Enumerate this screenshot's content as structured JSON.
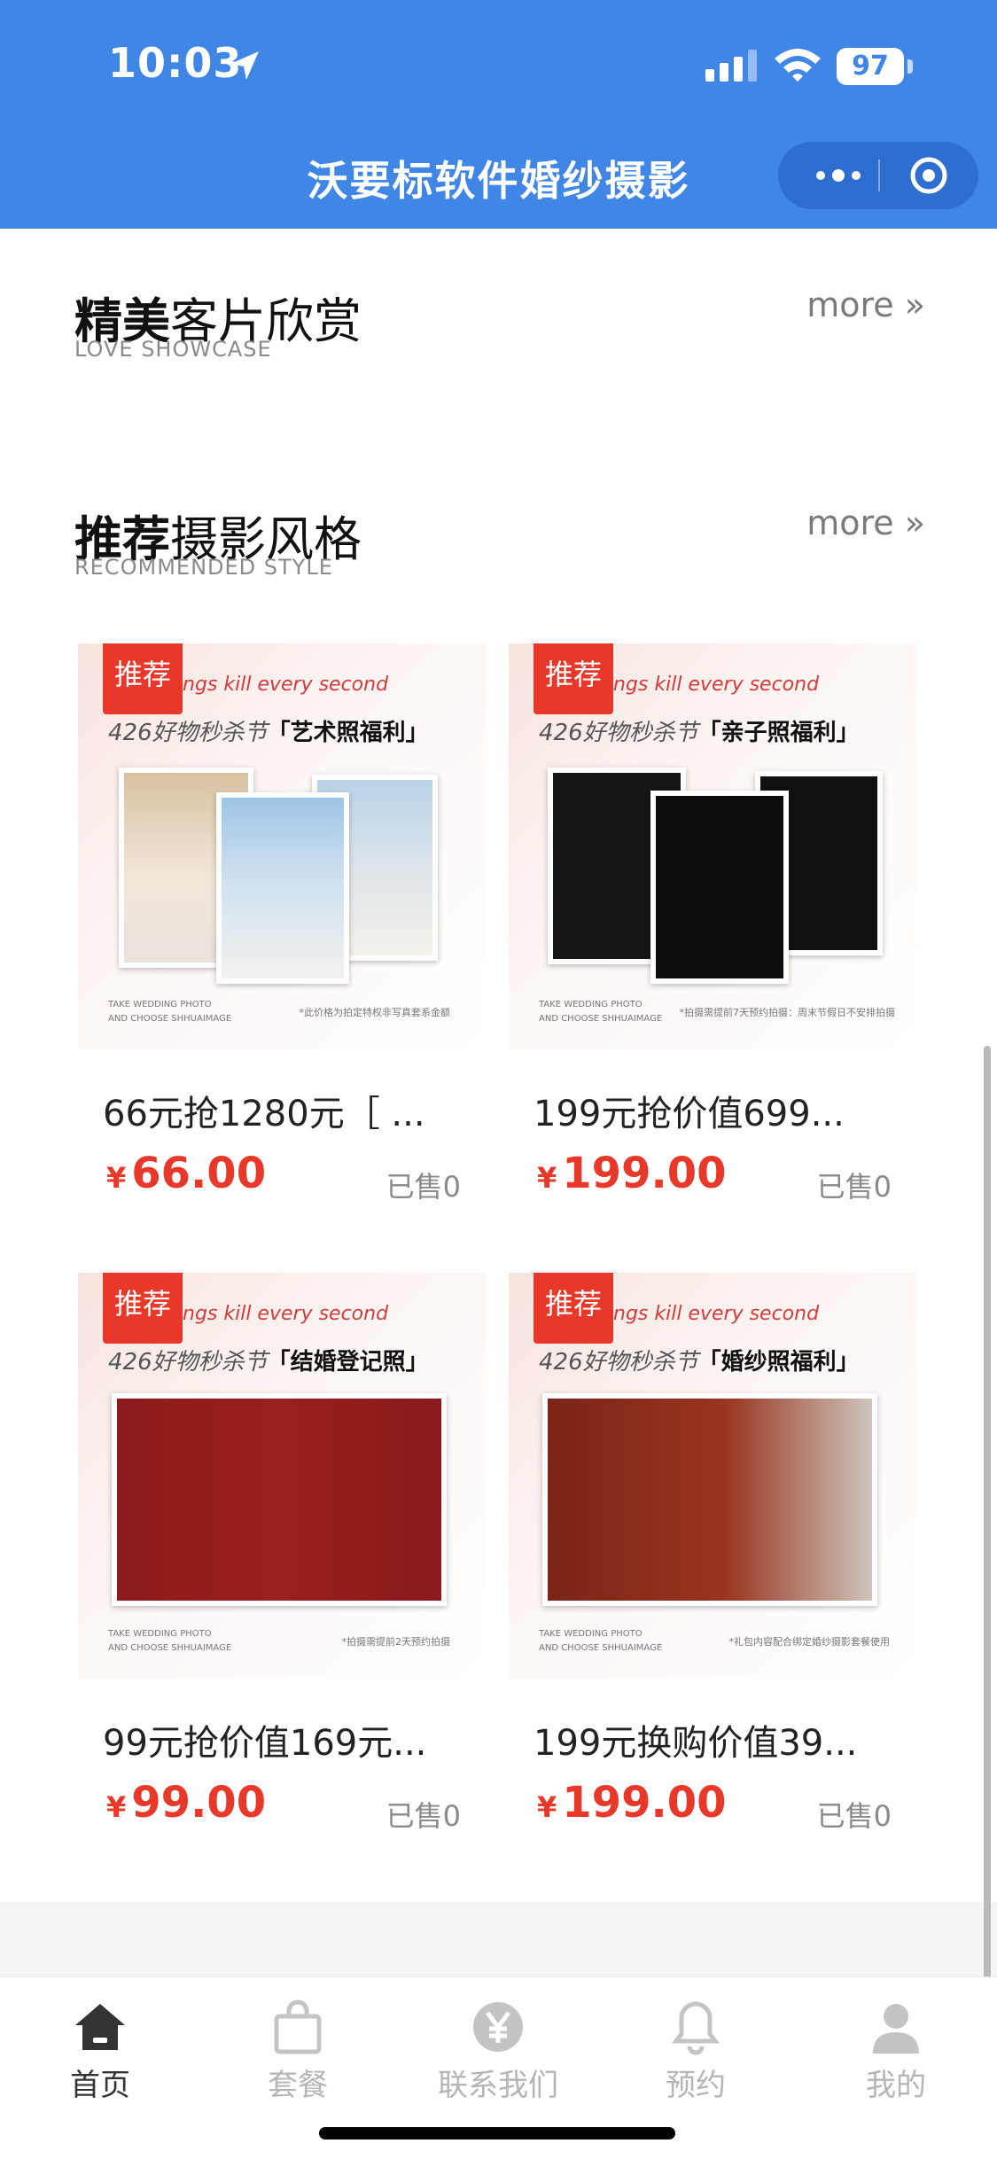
{
  "status_bar": {
    "time": "10:03",
    "battery": "97"
  },
  "nav": {
    "title": "沃要标软件婚纱摄影"
  },
  "sections": [
    {
      "title_bold": "精美",
      "title_rest": "客片欣赏",
      "subtitle": "LOVE SHOWCASE",
      "more": "more »"
    },
    {
      "title_bold": "推荐",
      "title_rest": "摄影风格",
      "subtitle": "RECOMMENDED STYLE",
      "more": "more »"
    }
  ],
  "products": [
    {
      "badge": "推荐",
      "banner_en": "ngs kill every second",
      "banner_cn_prefix": "426好物秒杀节",
      "banner_cn_tag": "「艺术照福利」",
      "foot_left_1": "TAKE WEDDING PHOTO",
      "foot_left_2": "AND CHOOSE SHHUAIMAGE",
      "foot_right": "*此价格为拍定特权非写真套系金额",
      "name": "66元抢1280元［ ...",
      "price": "66.00",
      "currency": "¥",
      "sold": "已售0"
    },
    {
      "badge": "推荐",
      "banner_en": "ngs kill every second",
      "banner_cn_prefix": "426好物秒杀节",
      "banner_cn_tag": "「亲子照福利」",
      "foot_left_1": "TAKE WEDDING PHOTO",
      "foot_left_2": "AND CHOOSE SHHUAIMAGE",
      "foot_right": "*拍摄需提前7天预约拍摄：周末节假日不安排拍摄",
      "name": "199元抢价值699...",
      "price": "199.00",
      "currency": "¥",
      "sold": "已售0"
    },
    {
      "badge": "推荐",
      "banner_en": "ngs kill every second",
      "banner_cn_prefix": "426好物秒杀节",
      "banner_cn_tag": "「结婚登记照」",
      "foot_left_1": "TAKE WEDDING PHOTO",
      "foot_left_2": "AND CHOOSE SHHUAIMAGE",
      "foot_right": "*拍摄需提前2天预约拍摄",
      "name": "99元抢价值169元...",
      "price": "99.00",
      "currency": "¥",
      "sold": "已售0"
    },
    {
      "badge": "推荐",
      "banner_en": "ngs kill every second",
      "banner_cn_prefix": "426好物秒杀节",
      "banner_cn_tag": "「婚纱照福利」",
      "foot_left_1": "TAKE WEDDING PHOTO",
      "foot_left_2": "AND CHOOSE SHHUAIMAGE",
      "foot_right": "*礼包内容配合绑定婚纱摄影套餐使用",
      "name": "199元换购价值39...",
      "price": "199.00",
      "currency": "¥",
      "sold": "已售0"
    }
  ],
  "tabs": [
    {
      "label": "首页",
      "icon": "home-icon",
      "active": true
    },
    {
      "label": "套餐",
      "icon": "bag-icon",
      "active": false
    },
    {
      "label": "联系我们",
      "icon": "yen-icon",
      "active": false
    },
    {
      "label": "预约",
      "icon": "bell-icon",
      "active": false
    },
    {
      "label": "我的",
      "icon": "user-icon",
      "active": false
    }
  ],
  "colors": {
    "nav_blue": "#3f86e6",
    "price_red": "#e8382a",
    "badge_red": "#e8382a"
  }
}
